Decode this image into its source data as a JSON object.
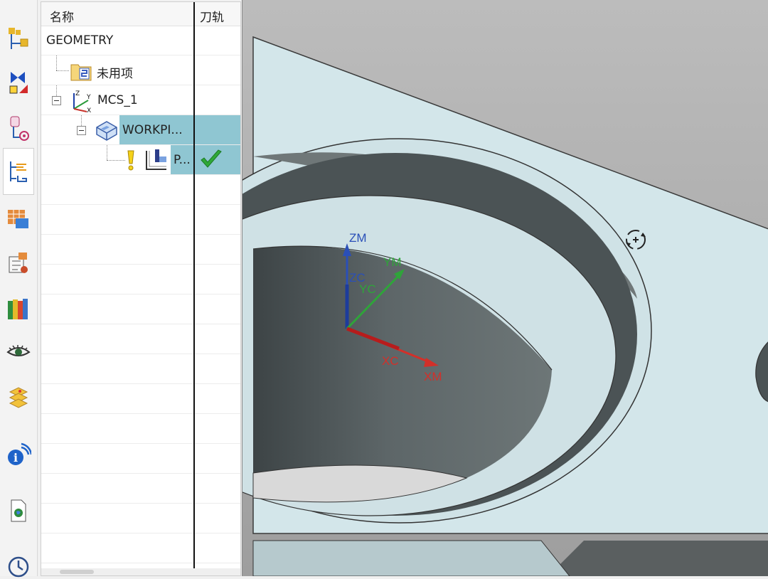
{
  "navigator": {
    "columns": {
      "name": "名称",
      "toolpath": "刀轨"
    },
    "rows": [
      {
        "label": "GEOMETRY"
      },
      {
        "label": "未用项"
      },
      {
        "label": "MCS_1"
      },
      {
        "label": "WORKPI..."
      },
      {
        "label": "P..."
      }
    ]
  },
  "toolbar": {
    "icons": [
      "operation-icon",
      "geometry-icon",
      "method-icon",
      "operation-navigator-icon",
      "machine-tool-icon",
      "program-icon",
      "library-icon",
      "view-icon",
      "feature-icon",
      "information-icon",
      "document-icon",
      "history-icon"
    ]
  },
  "viewport": {
    "axes": {
      "zm": "ZM",
      "zc": "ZC",
      "ym": "YM",
      "yc": "YC",
      "xc": "XC",
      "xm": "XM"
    },
    "colors": {
      "z_axis": "#2a4fb8",
      "y_axis": "#2fa43a",
      "x_axis": "#d2302a",
      "surface": "#d3e6ea",
      "selection": "#8fc6d2"
    }
  }
}
